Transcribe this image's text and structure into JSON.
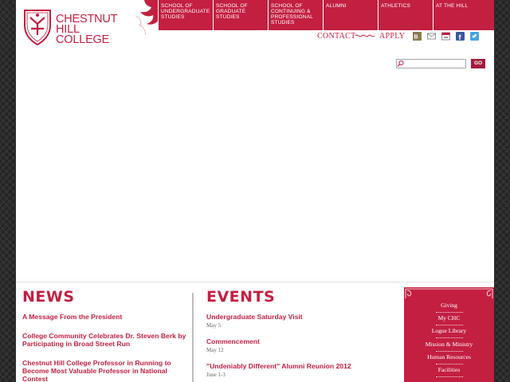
{
  "header": {
    "logo_lines": [
      "CHESTNUT",
      "HILL",
      "COLLEGE"
    ],
    "nav": [
      {
        "label": "School of Undergraduate Studies"
      },
      {
        "label": "School of Graduate Studies"
      },
      {
        "label": "School of Continuing & Professional Studies"
      },
      {
        "label": "Alumni"
      },
      {
        "label": "Athletics"
      },
      {
        "label": "At The Hill"
      }
    ],
    "utility": {
      "contact": "CONTACT",
      "apply": "APPLY"
    },
    "social": [
      "blog-icon",
      "email-icon",
      "calendar-icon",
      "facebook-icon",
      "twitter-icon"
    ],
    "search": {
      "placeholder": "",
      "button": "GO"
    }
  },
  "news": {
    "heading": "NEWS",
    "items": [
      "A Message From the President",
      "College Community Celebrates Dr. Steven Berk by Participating in Broad Street Run",
      "Chestnut Hill College Professor in Running to Become Most Valuable Professor in National Contest"
    ]
  },
  "events": {
    "heading": "EVENTS",
    "items": [
      {
        "title": "Undergraduate Saturday Visit",
        "date": "May 5"
      },
      {
        "title": "Commencement",
        "date": "May 12"
      },
      {
        "title": "\"Undeniably Different\" Alumni Reunion 2012",
        "date": "June 1-3"
      }
    ]
  },
  "quicklinks": [
    "Giving",
    "My CHC",
    "Logue Library",
    "Mission & Ministry",
    "Human Resources",
    "Facilities"
  ],
  "colors": {
    "brand": "#c31f41",
    "dark_brand": "#a31c3b",
    "page_bg": "#2c2c2c"
  }
}
